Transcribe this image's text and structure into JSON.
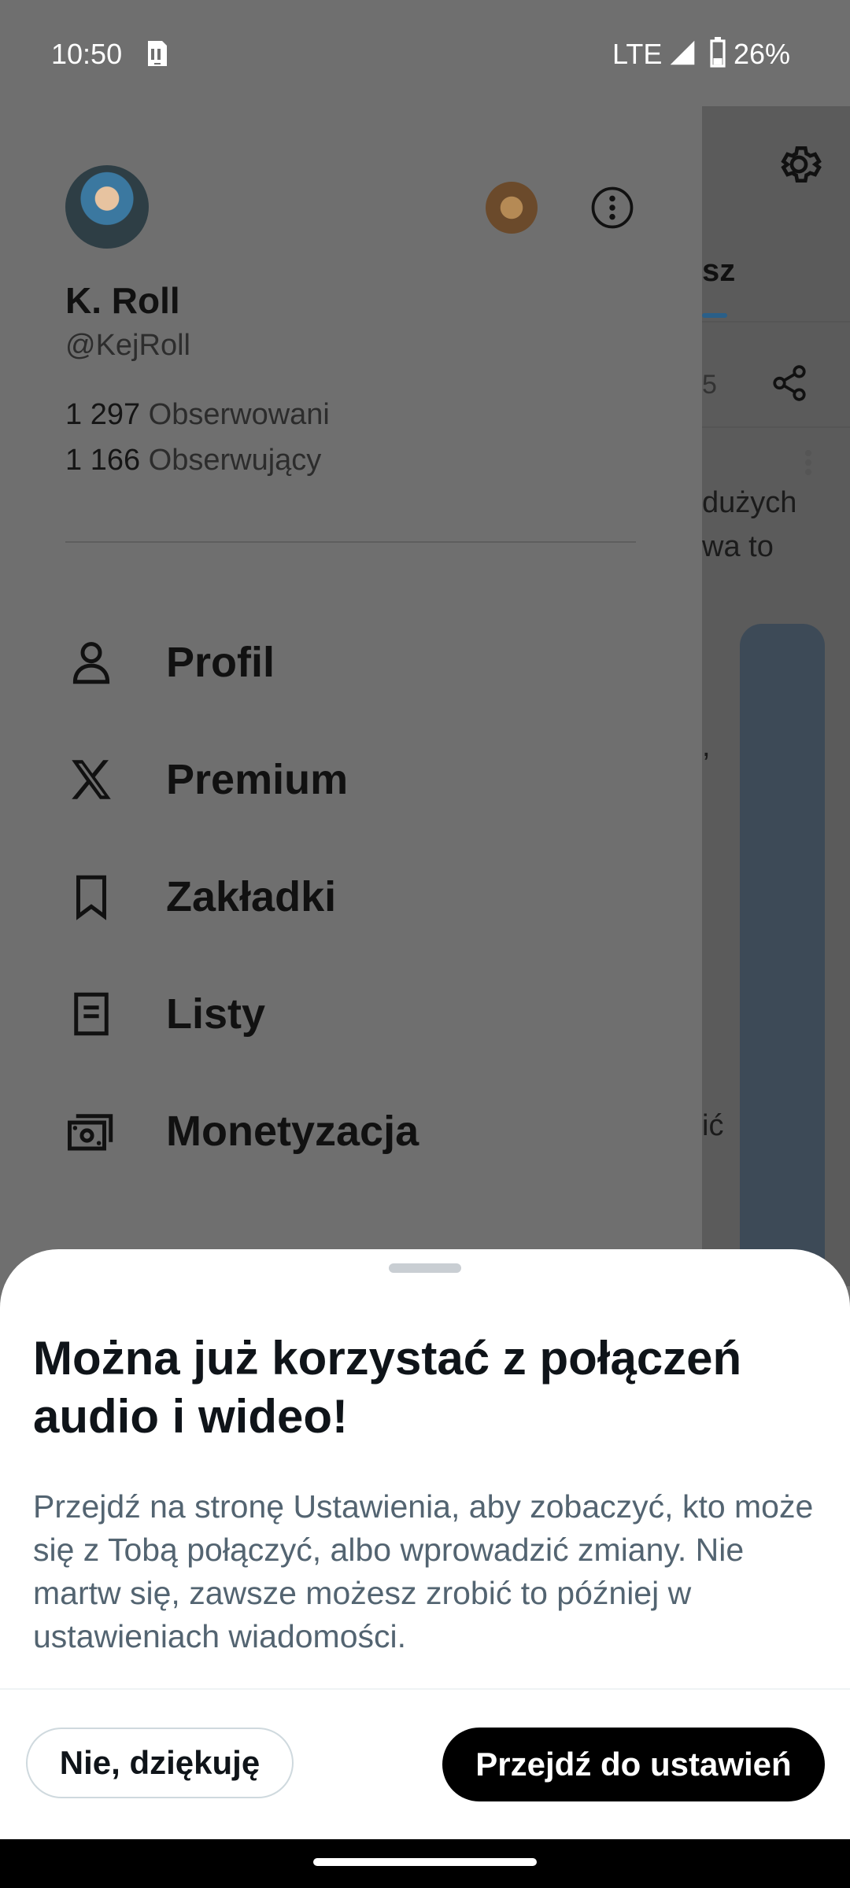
{
  "status_bar": {
    "time": "10:50",
    "network": "LTE",
    "battery": "26%"
  },
  "background": {
    "tab_fragment": "sz",
    "count_fragment": "5",
    "text_lines": [
      "dużych",
      "wa to",
      "",
      ",",
      "ić"
    ]
  },
  "drawer": {
    "profile": {
      "name": "K. Roll",
      "handle": "@KejRoll"
    },
    "stats": [
      {
        "count": "1 297",
        "label": "Obserwowani"
      },
      {
        "count": "1 166",
        "label": "Obserwujący"
      }
    ],
    "menu": [
      {
        "label": "Profil",
        "icon": "person-icon"
      },
      {
        "label": "Premium",
        "icon": "x-logo-icon"
      },
      {
        "label": "Zakładki",
        "icon": "bookmark-icon"
      },
      {
        "label": "Listy",
        "icon": "list-icon"
      },
      {
        "label": "Monetyzacja",
        "icon": "money-icon"
      }
    ]
  },
  "sheet": {
    "title": "Można już korzystać z połączeń audio i wideo!",
    "body": "Przejdź na stronę Ustawienia, aby zobaczyć, kto może się z Tobą połączyć, albo wprowadzić zmiany. Nie martw się, zawsze możesz zrobić to później w ustawieniach wiadomości.",
    "secondary_button": "Nie, dziękuję",
    "primary_button": "Przejdź do ustawień"
  },
  "colors": {
    "primary_button_bg": "#000000",
    "body_text": "#536471",
    "title_text": "#0f1419",
    "overlay": "#6f6f6f"
  }
}
